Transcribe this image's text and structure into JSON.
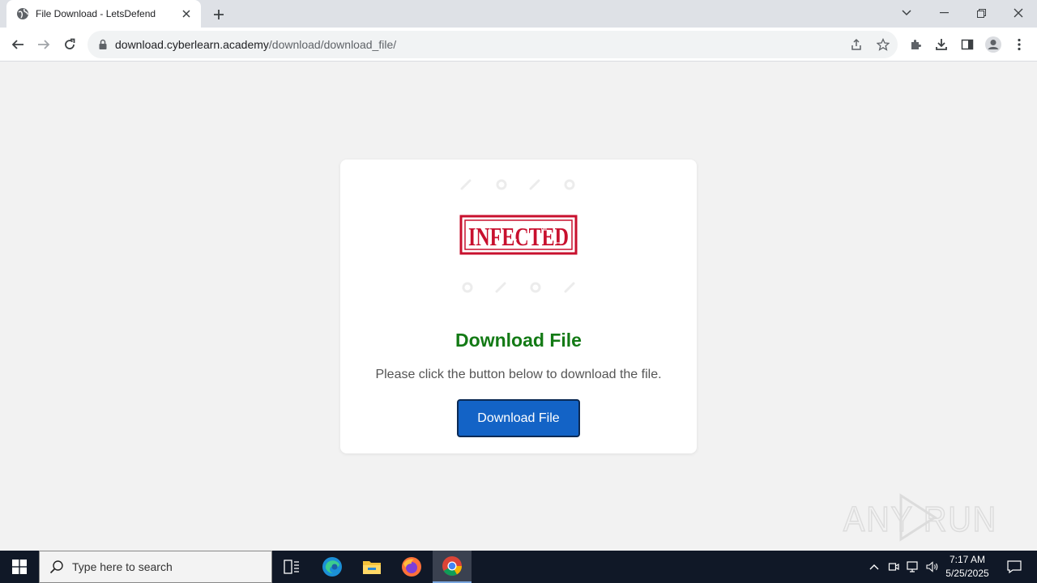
{
  "browser": {
    "tab_title": "File Download - LetsDefend",
    "url_host": "download.cyberlearn.academy",
    "url_path": "/download/download_file/"
  },
  "page": {
    "stamp_text": "INFECTED",
    "heading": "Download File",
    "instruction": "Please click the button below to download the file.",
    "button_label": "Download File",
    "colors": {
      "heading": "#137a15",
      "button": "#1363c6",
      "stamp": "#c8102e"
    }
  },
  "watermark": {
    "text": "ANY RUN"
  },
  "taskbar": {
    "search_placeholder": "Type here to search",
    "time": "7:17 AM",
    "date": "5/25/2025",
    "apps": [
      "task-view",
      "edge",
      "file-explorer",
      "firefox",
      "chrome"
    ]
  }
}
